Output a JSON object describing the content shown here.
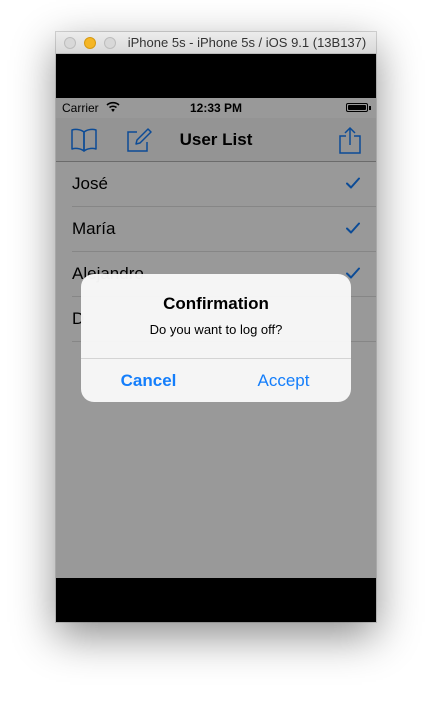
{
  "window": {
    "title": "iPhone 5s - iPhone 5s / iOS 9.1 (13B137)"
  },
  "statusbar": {
    "carrier": "Carrier",
    "time": "12:33 PM",
    "battery_level": 1.0
  },
  "navbar": {
    "title": "User List",
    "left_icons": [
      "book-icon",
      "compose-icon"
    ],
    "right_icon": "share-icon"
  },
  "list": {
    "items": [
      {
        "name": "José",
        "checked": true
      },
      {
        "name": "María",
        "checked": true
      },
      {
        "name": "Alejandro",
        "checked": true
      },
      {
        "name": "D",
        "checked": false
      }
    ]
  },
  "alert": {
    "title": "Confirmation",
    "message": "Do you want to log off?",
    "cancel_label": "Cancel",
    "accept_label": "Accept"
  },
  "colors": {
    "tint": "#147efb",
    "overlay": "rgba(0,0,0,0.40)",
    "navbar_bg": "#f7f7f7"
  }
}
